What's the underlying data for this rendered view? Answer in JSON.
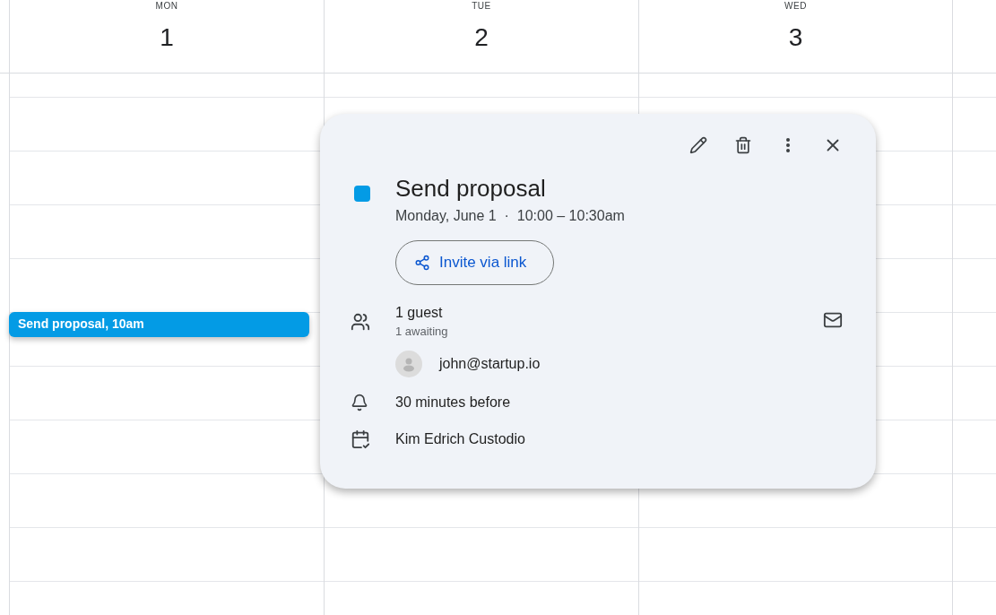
{
  "days": [
    {
      "name": "MON",
      "date": "1"
    },
    {
      "name": "TUE",
      "date": "2"
    },
    {
      "name": "WED",
      "date": "3"
    }
  ],
  "event": {
    "label": "Send proposal, 10am",
    "color": "#039be5"
  },
  "popup": {
    "actions": [
      {
        "kind": "edit"
      },
      {
        "kind": "delete"
      },
      {
        "kind": "more"
      },
      {
        "kind": "close"
      }
    ],
    "title": "Send proposal",
    "color": "#039be5",
    "when": "Monday, June 1  ·  10:00 – 10:30am",
    "invite_button": "Invite via link",
    "guests": {
      "count": "1 guest",
      "status": "1 awaiting",
      "list": [
        "john@startup.io"
      ]
    },
    "reminder": "30 minutes before",
    "calendar": "Kim Edrich Custodio"
  }
}
